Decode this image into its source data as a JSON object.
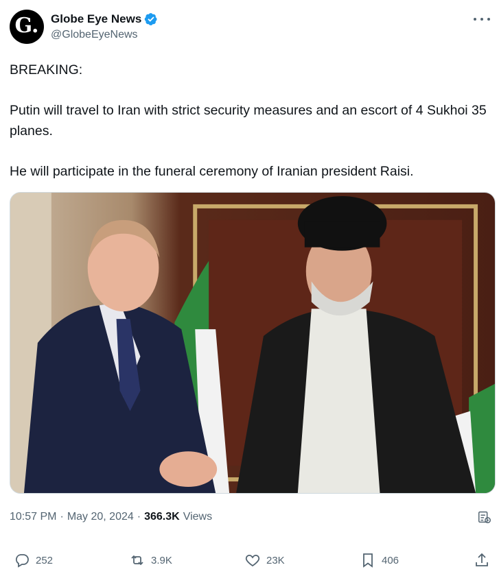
{
  "author": {
    "avatar_letter": "G.",
    "display_name": "Globe Eye News",
    "handle": "@GlobeEyeNews",
    "verified": true
  },
  "tweet": {
    "lines": [
      "BREAKING:",
      "Putin will travel to Iran with strict security measures and an escort of 4 Sukhoi 35 planes.",
      "He will participate in the funeral ceremony of Iranian president Raisi."
    ]
  },
  "media": {
    "alt_icons": [
      "person-suit-left",
      "person-cleric-right",
      "iranian-flag"
    ]
  },
  "meta": {
    "time": "10:57 PM",
    "date": "May 20, 2024",
    "views_count": "366.3K",
    "views_label": "Views"
  },
  "actions": {
    "replies": "252",
    "retweets": "3.9K",
    "likes": "23K",
    "bookmarks": "406"
  },
  "colors": {
    "text": "#0f1419",
    "secondary": "#536471",
    "verified_blue": "#1d9bf0"
  }
}
